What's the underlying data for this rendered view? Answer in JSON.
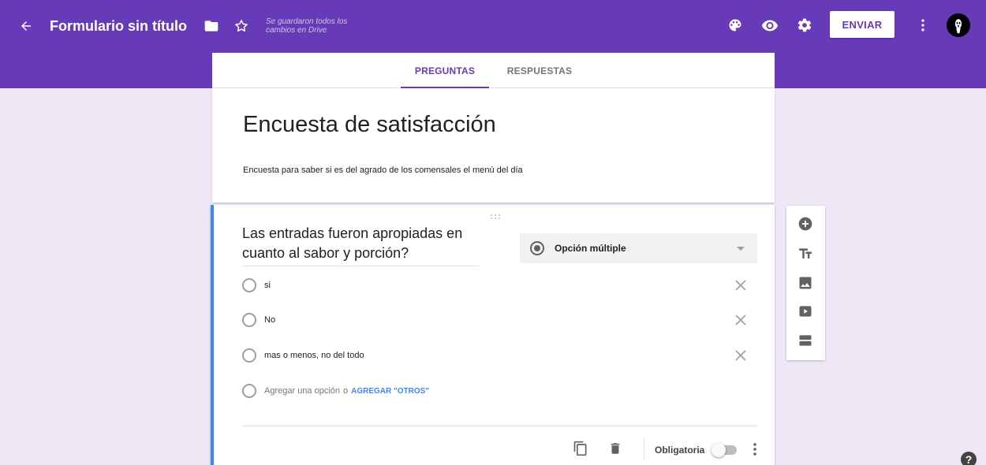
{
  "header": {
    "form_title": "Formulario sin título",
    "saved_status": "Se guardaron todos los cambios en Drive",
    "send_label": "ENVIAR"
  },
  "tabs": [
    {
      "label": "PREGUNTAS",
      "active": true
    },
    {
      "label": "RESPUESTAS",
      "active": false
    }
  ],
  "form": {
    "title": "Encuesta de satisfacción",
    "description": "Encuesta para saber si es del agrado de los comensales el menú del día"
  },
  "question": {
    "title": "Las entradas fueron apropiadas en cuanto al sabor y porción?",
    "type": "Opción múltiple",
    "options": [
      "si",
      "No",
      "mas o menos, no del todo"
    ],
    "add_option_label": "Agregar una opción",
    "or_label": "o",
    "add_other_label": "AGREGAR \"OTROS\"",
    "required_label": "Obligatoria",
    "required": false
  },
  "side_toolbar": {
    "icons": [
      "add-question-icon",
      "title-icon",
      "image-icon",
      "video-icon",
      "section-icon"
    ]
  },
  "colors": {
    "primary": "#673ab7",
    "background": "#ede7f6",
    "accent": "#4285f4"
  }
}
